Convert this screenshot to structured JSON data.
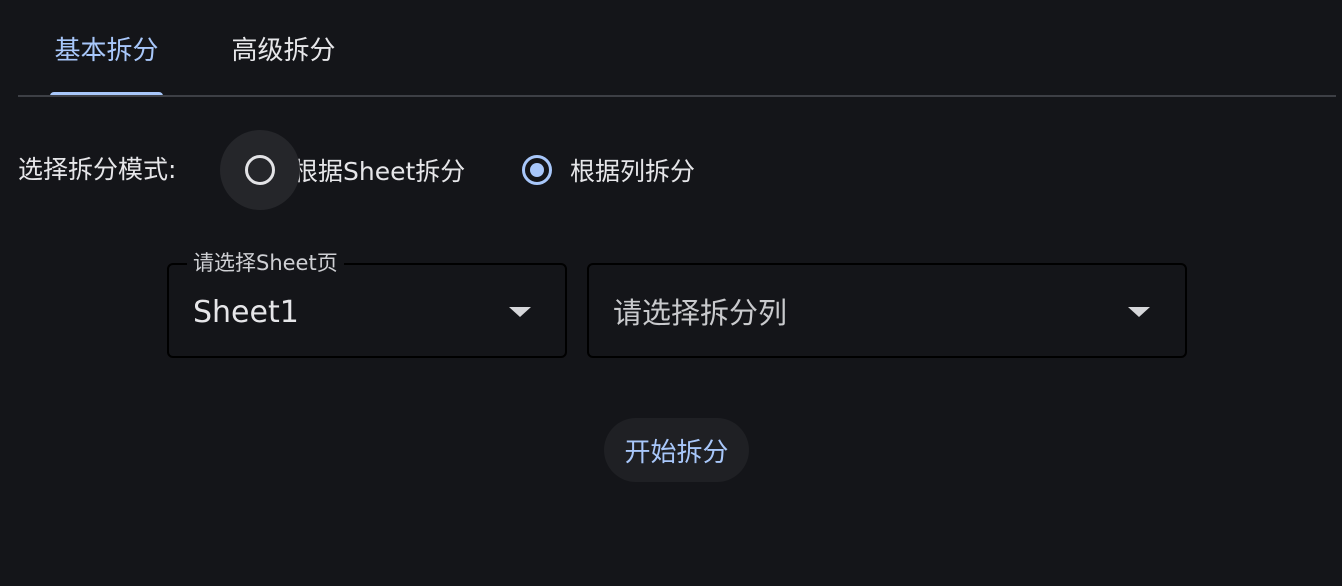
{
  "tabs": [
    {
      "label": "基本拆分",
      "active": true
    },
    {
      "label": "高级拆分",
      "active": false
    }
  ],
  "mode": {
    "label": "选择拆分模式:",
    "options": [
      {
        "label": "根据Sheet拆分",
        "checked": false
      },
      {
        "label": "根据列拆分",
        "checked": true
      }
    ]
  },
  "sheet_select": {
    "label": "请选择Sheet页",
    "value": "Sheet1"
  },
  "column_select": {
    "placeholder": "请选择拆分列"
  },
  "action": {
    "start_label": "开始拆分"
  },
  "colors": {
    "background": "#141519",
    "accent": "#a8c7fa",
    "text": "#e6e6e9"
  }
}
